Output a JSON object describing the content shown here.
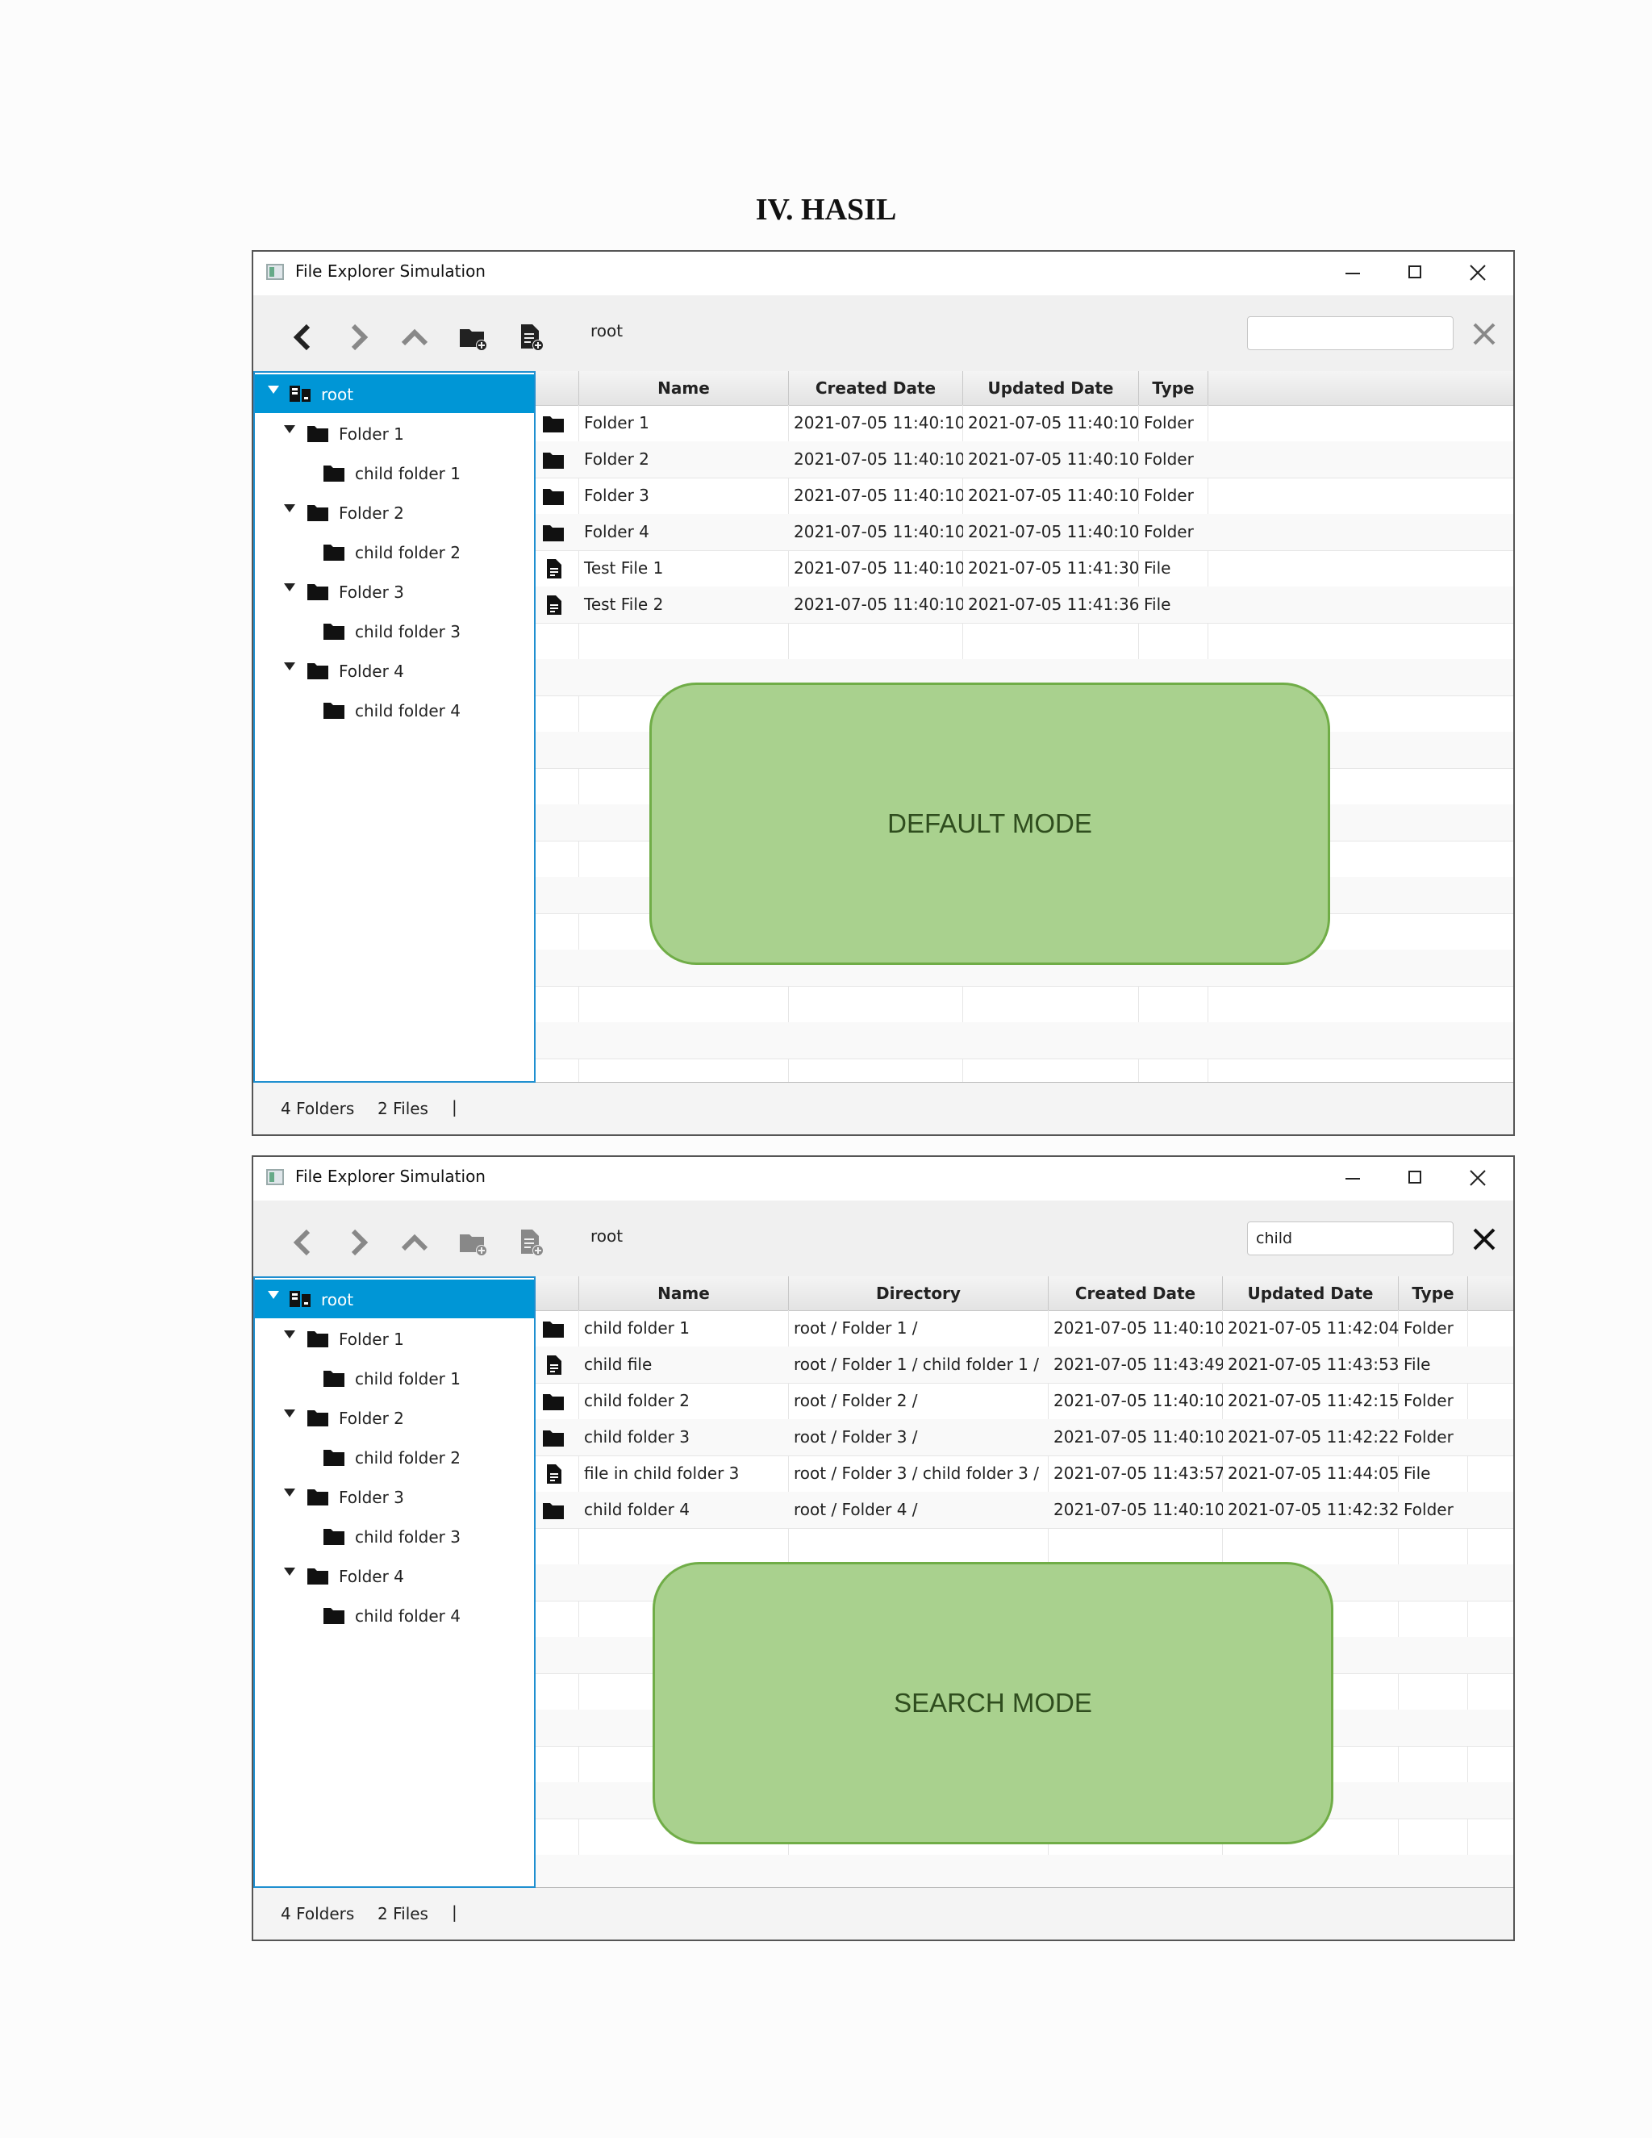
{
  "heading": "IV.  HASIL",
  "window_title": "File Explorer Simulation",
  "path_label": "root",
  "icons": {
    "back": "chevron-left-icon",
    "forward": "chevron-right-icon",
    "up": "chevron-up-icon",
    "new_folder": "new-folder-icon",
    "new_file": "new-file-icon",
    "clear": "close-icon",
    "folder": "folder-icon",
    "file": "file-icon",
    "root": "root-drive-icon"
  },
  "colors": {
    "selection": "#0096d6",
    "sidebar_border": "#1f8fd0",
    "banner_fill": "#a9d18e",
    "banner_border": "#70ad47"
  },
  "tree": [
    {
      "label": "root",
      "level": 0,
      "expanded": true,
      "selected": true,
      "icon": "root"
    },
    {
      "label": "Folder 1",
      "level": 1,
      "expanded": true
    },
    {
      "label": "child folder 1",
      "level": 2
    },
    {
      "label": "Folder 2",
      "level": 1,
      "expanded": true
    },
    {
      "label": "child folder 2",
      "level": 2
    },
    {
      "label": "Folder 3",
      "level": 1,
      "expanded": true
    },
    {
      "label": "child folder 3",
      "level": 2
    },
    {
      "label": "Folder 4",
      "level": 1,
      "expanded": true
    },
    {
      "label": "child folder 4",
      "level": 2
    }
  ],
  "default_mode": {
    "search_value": "",
    "toolbar_disabled": false,
    "banner": "DEFAULT MODE",
    "columns": [
      "Name",
      "Created Date",
      "Updated Date",
      "Type"
    ],
    "rows": [
      {
        "icon": "folder",
        "cells": [
          "Folder 1",
          "2021-07-05 11:40:10",
          "2021-07-05 11:40:10",
          "Folder"
        ]
      },
      {
        "icon": "folder",
        "cells": [
          "Folder 2",
          "2021-07-05 11:40:10",
          "2021-07-05 11:40:10",
          "Folder"
        ]
      },
      {
        "icon": "folder",
        "cells": [
          "Folder 3",
          "2021-07-05 11:40:10",
          "2021-07-05 11:40:10",
          "Folder"
        ]
      },
      {
        "icon": "folder",
        "cells": [
          "Folder 4",
          "2021-07-05 11:40:10",
          "2021-07-05 11:40:10",
          "Folder"
        ]
      },
      {
        "icon": "file",
        "cells": [
          "Test File 1",
          "2021-07-05 11:40:10",
          "2021-07-05 11:41:30",
          "File"
        ]
      },
      {
        "icon": "file",
        "cells": [
          "Test File 2",
          "2021-07-05 11:40:10",
          "2021-07-05 11:41:36",
          "File"
        ]
      }
    ],
    "status": {
      "folders": "4 Folders",
      "files": "2 Files",
      "separator": "|"
    }
  },
  "search_mode": {
    "search_value": "child",
    "toolbar_disabled": true,
    "banner": "SEARCH MODE",
    "columns": [
      "Name",
      "Directory",
      "Created Date",
      "Updated Date",
      "Type"
    ],
    "rows": [
      {
        "icon": "folder",
        "cells": [
          "child folder 1",
          "root / Folder 1 /",
          "2021-07-05 11:40:10",
          "2021-07-05 11:42:04",
          "Folder"
        ]
      },
      {
        "icon": "file",
        "cells": [
          "child file",
          "root / Folder 1 / child folder 1 /",
          "2021-07-05 11:43:49",
          "2021-07-05 11:43:53",
          "File"
        ]
      },
      {
        "icon": "folder",
        "cells": [
          "child folder 2",
          "root / Folder 2 /",
          "2021-07-05 11:40:10",
          "2021-07-05 11:42:15",
          "Folder"
        ]
      },
      {
        "icon": "folder",
        "cells": [
          "child folder 3",
          "root / Folder 3 /",
          "2021-07-05 11:40:10",
          "2021-07-05 11:42:22",
          "Folder"
        ]
      },
      {
        "icon": "file",
        "cells": [
          "file in child folder 3",
          "root / Folder 3 / child folder 3 /",
          "2021-07-05 11:43:57",
          "2021-07-05 11:44:05",
          "File"
        ]
      },
      {
        "icon": "folder",
        "cells": [
          "child folder 4",
          "root / Folder 4 /",
          "2021-07-05 11:40:10",
          "2021-07-05 11:42:32",
          "Folder"
        ]
      }
    ],
    "status": {
      "folders": "4 Folders",
      "files": "2 Files",
      "separator": "|"
    }
  }
}
